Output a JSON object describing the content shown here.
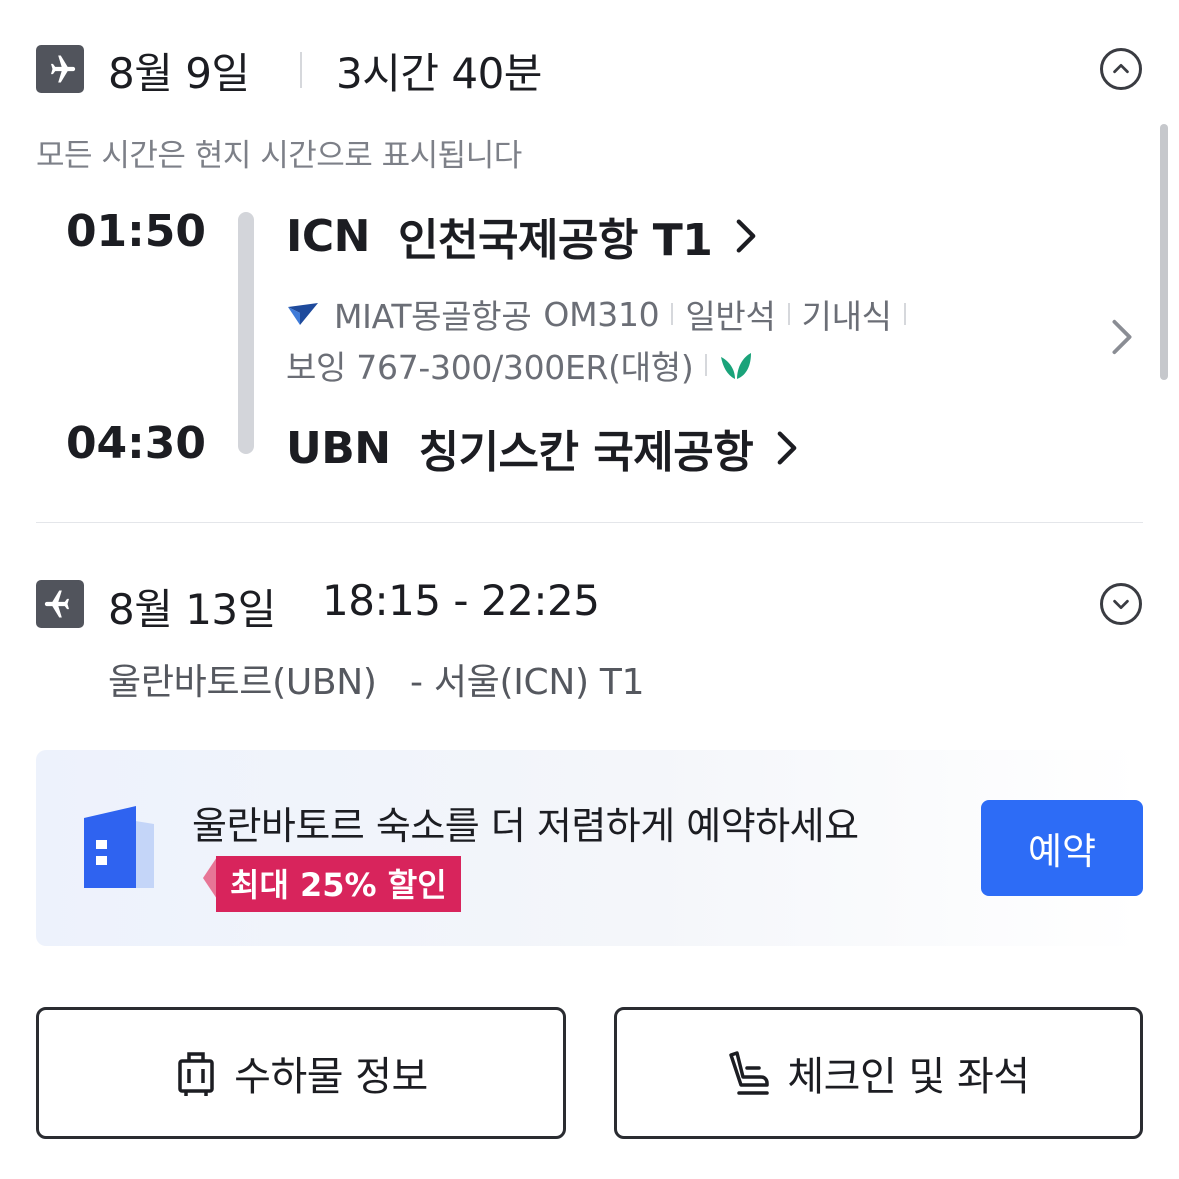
{
  "outbound": {
    "date": "8월 9일",
    "duration": "3시간 40분",
    "local_time_note": "모든 시간은 현지 시간으로 표시됩니다",
    "departure": {
      "time": "01:50",
      "code": "ICN",
      "airport": "인천국제공항 T1"
    },
    "arrival": {
      "time": "04:30",
      "code": "UBN",
      "airport": "칭기스칸 국제공항"
    },
    "airline": "MIAT몽골항공",
    "flight_no": "OM310",
    "cabin": "일반석",
    "meal": "기내식",
    "aircraft": "보잉 767-300/300ER(대형)",
    "icons": {
      "toggle": "chevron-up-icon",
      "eco": "leaf-icon"
    }
  },
  "return": {
    "date": "8월 13일",
    "time_range": "18:15 - 22:25",
    "origin": "울란바토르(UBN)",
    "destination": "- 서울(ICN) T1",
    "icons": {
      "toggle": "chevron-down-icon"
    }
  },
  "promo": {
    "text": "울란바토르 숙소를 더 저렴하게 예약하세요",
    "badge": "최대 25% 할인",
    "button": "예약",
    "colors": {
      "button": "#2d6cf6",
      "badge": "#d8245c"
    }
  },
  "actions": {
    "baggage": "수하물 정보",
    "checkin": "체크인 및 좌석"
  }
}
